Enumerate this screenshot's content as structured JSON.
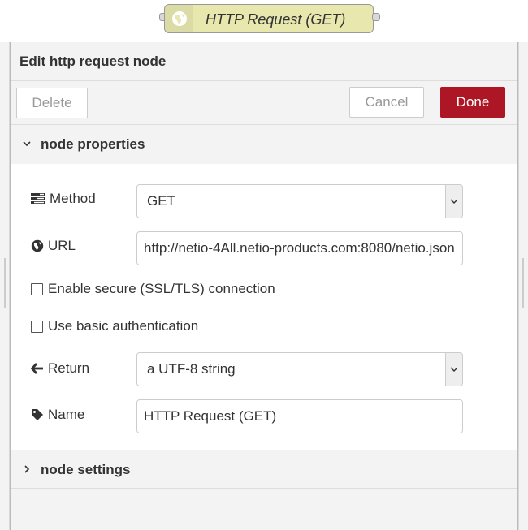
{
  "node": {
    "label": "HTTP Request (GET)",
    "icon": "globe-icon"
  },
  "tray": {
    "title": "Edit http request node"
  },
  "toolbar": {
    "delete_label": "Delete",
    "cancel_label": "Cancel",
    "done_label": "Done"
  },
  "sections": {
    "properties": {
      "title": "node properties",
      "expanded": true
    },
    "settings": {
      "title": "node settings",
      "expanded": false
    }
  },
  "form": {
    "method": {
      "label": "Method",
      "icon": "tasks-icon",
      "value": "GET"
    },
    "url": {
      "label": "URL",
      "icon": "globe-icon",
      "value": "http://netio-4All.netio-products.com:8080/netio.json"
    },
    "tls": {
      "label": "Enable secure (SSL/TLS) connection",
      "checked": false
    },
    "auth": {
      "label": "Use basic authentication",
      "checked": false
    },
    "ret": {
      "label": "Return",
      "icon": "arrow-left-icon",
      "value": "a UTF-8 string"
    },
    "name": {
      "label": "Name",
      "icon": "tag-icon",
      "value": "HTTP Request (GET)"
    }
  },
  "colors": {
    "accent": "#ad1625",
    "node": "#e7e7ae"
  }
}
